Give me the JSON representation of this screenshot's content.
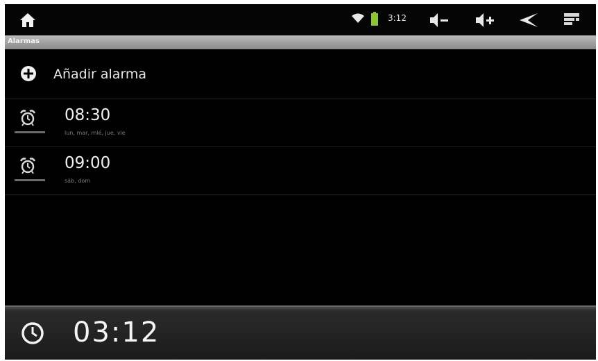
{
  "status_bar": {
    "time": "3:12",
    "icons": [
      "home-icon",
      "wifi-icon",
      "battery-icon",
      "volume-down-icon",
      "volume-up-icon",
      "back-icon",
      "menu-icon"
    ]
  },
  "title": "Alarmas",
  "add_alarm": {
    "label": "Añadir alarma",
    "icon": "add-circle-icon"
  },
  "alarms": [
    {
      "time": "08:30",
      "days": "lun, mar, mié, jue, vie",
      "icon": "alarm-clock-icon"
    },
    {
      "time": "09:00",
      "days": "sáb, dom",
      "icon": "alarm-clock-icon"
    }
  ],
  "clock": {
    "time": "03:12",
    "icon": "clock-icon"
  },
  "colors": {
    "background": "#000000",
    "title_bar": "#a0a0a0",
    "text": "#f0f0f0",
    "subtext": "#7d7d7d"
  }
}
